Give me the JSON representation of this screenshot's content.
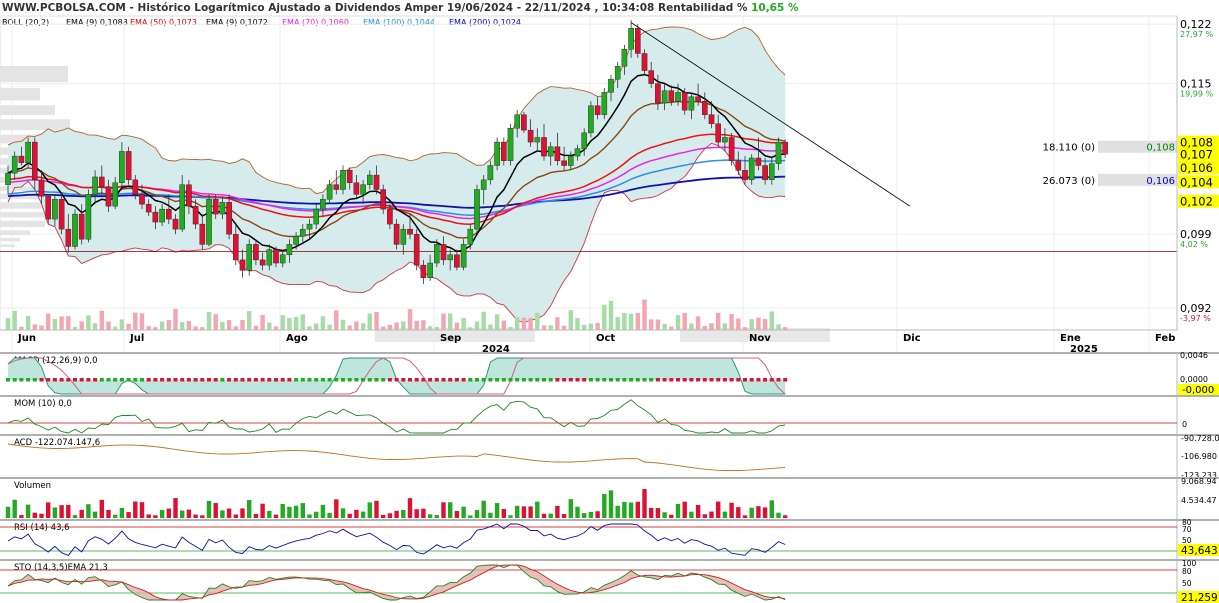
{
  "header": {
    "site": "WWW.PCBOLSA.COM",
    "title_rest": " - Histórico Logarítmico  Ajustado a Dividendos Amper 19/06/2024 - 22/11/2024 , 10:34:08 Rentabilidad %",
    "rentabilidad": "10,65 %"
  },
  "legend": [
    {
      "label": "BOLL (20,2)",
      "color": "#000000"
    },
    {
      "label": "EMA (9) 0,1088",
      "color": "#000000"
    },
    {
      "label": "EMA (50) 0,1073",
      "color": "#e00000"
    },
    {
      "label": "EMA (9) 0,1072",
      "color": "#000000"
    },
    {
      "label": "EMA (70) 0,1060",
      "color": "#e020e0"
    },
    {
      "label": "EMA (100) 0,1044",
      "color": "#2090e0"
    },
    {
      "label": "EMA (200) 0,1024",
      "color": "#0000c0"
    }
  ],
  "colors": {
    "up": "#22aa22",
    "down": "#dd1133",
    "boll_fill": "#d6ecec",
    "boll_line": "#b8602a",
    "ema9": "#000000",
    "ema_brown": "#8b4513",
    "ema50": "#ee1111",
    "ema70": "#ee22ee",
    "ema100": "#2b90e0",
    "ema200": "#1010b0",
    "highlight": "#ffff00",
    "pane_sep": "#b0b0b0"
  },
  "price_axis": {
    "labels": [
      {
        "text": "0,122",
        "pct": "27,97 %",
        "val": 0.122
      },
      {
        "text": "0,115",
        "pct": "19,99 %",
        "val": 0.115
      },
      {
        "text": "0,099",
        "pct": "4,02 %",
        "val": 0.099
      },
      {
        "text": "0,092",
        "pct": "-3,97 %",
        "val": 0.092
      }
    ],
    "boxes": [
      {
        "text": "0,108",
        "val": 0.1085
      },
      {
        "text": "0,107",
        "val": 0.1072
      },
      {
        "text": "0,106",
        "val": 0.1058
      },
      {
        "text": "0,104",
        "val": 0.1043
      },
      {
        "text": "0,102",
        "val": 0.1023
      }
    ],
    "orders": [
      {
        "qty": "18.110 (0)",
        "price": "0,108",
        "val": 0.108,
        "color": "#008800"
      },
      {
        "qty": "26.073 (0)",
        "price": "0,106",
        "val": 0.1045,
        "color": "#0000cc"
      }
    ],
    "hline": 0.0973
  },
  "time_axis": {
    "months": [
      "Jun",
      "Jul",
      "Ago",
      "Sep",
      "Oct",
      "Nov",
      "Dic",
      "Ene",
      "Feb"
    ],
    "years": [
      "2024",
      "2025"
    ]
  },
  "panes": {
    "macd": {
      "label": "MACD (12,26,9) 0,0",
      "ticks": [
        "0,0046",
        "0,0000"
      ],
      "box": "-0,000"
    },
    "mom": {
      "label": "MOM (10) 0,0",
      "ticks": [
        "0"
      ]
    },
    "acd": {
      "label": "ACD -122.074.147,6",
      "ticks": [
        "-90.728.0",
        "-106.980",
        "-123.233"
      ]
    },
    "volumen": {
      "label": "Volumen",
      "ticks": [
        "9.068.94",
        "4.534.47"
      ]
    },
    "rsi": {
      "label": "RSI (14) 43,6",
      "ticks": [
        "80",
        "70",
        "50",
        "30"
      ],
      "box": "43,643"
    },
    "sto": {
      "label": "STO (14,3,5)EMA 21,3",
      "ticks": [
        "100",
        "80",
        "50",
        "20"
      ],
      "box": "21,259"
    }
  },
  "chart_data": {
    "type": "candlestick",
    "title": "Amper 19/06/2024 - 22/11/2024",
    "scale": "log",
    "ylim": [
      0.09,
      0.123
    ],
    "candles": [
      [
        0.104,
        0.106,
        0.103,
        0.1052
      ],
      [
        0.1052,
        0.1075,
        0.1045,
        0.107
      ],
      [
        0.107,
        0.108,
        0.106,
        0.1063
      ],
      [
        0.1063,
        0.109,
        0.1058,
        0.1085
      ],
      [
        0.1085,
        0.109,
        0.1035,
        0.1045
      ],
      [
        0.1045,
        0.1055,
        0.102,
        0.1028
      ],
      [
        0.1028,
        0.103,
        0.1,
        0.1005
      ],
      [
        0.1005,
        0.103,
        0.0998,
        0.1025
      ],
      [
        0.1025,
        0.1032,
        0.099,
        0.0995
      ],
      [
        0.0995,
        0.101,
        0.0972,
        0.0978
      ],
      [
        0.0978,
        0.1015,
        0.0975,
        0.101
      ],
      [
        0.101,
        0.102,
        0.098,
        0.0985
      ],
      [
        0.0985,
        0.1035,
        0.0982,
        0.103
      ],
      [
        0.103,
        0.1055,
        0.102,
        0.1048
      ],
      [
        0.1048,
        0.106,
        0.103,
        0.1038
      ],
      [
        0.1038,
        0.1045,
        0.1012,
        0.1018
      ],
      [
        0.1018,
        0.1048,
        0.1015,
        0.1042
      ],
      [
        0.1042,
        0.1085,
        0.1038,
        0.1075
      ],
      [
        0.1075,
        0.108,
        0.104,
        0.1045
      ],
      [
        0.1045,
        0.105,
        0.1025,
        0.103
      ],
      [
        0.103,
        0.104,
        0.1015,
        0.102
      ],
      [
        0.102,
        0.1025,
        0.1008,
        0.1012
      ],
      [
        0.1012,
        0.1018,
        0.0995,
        0.1002
      ],
      [
        0.1002,
        0.102,
        0.0998,
        0.1015
      ],
      [
        0.1015,
        0.103,
        0.1,
        0.1005
      ],
      [
        0.1005,
        0.101,
        0.099,
        0.0995
      ],
      [
        0.0995,
        0.105,
        0.0992,
        0.104
      ],
      [
        0.104,
        0.1045,
        0.101,
        0.1018
      ],
      [
        0.1018,
        0.1025,
        0.0995,
        0.1
      ],
      [
        0.1,
        0.101,
        0.0975,
        0.098
      ],
      [
        0.098,
        0.103,
        0.0978,
        0.1025
      ],
      [
        0.1025,
        0.103,
        0.1005,
        0.101
      ],
      [
        0.101,
        0.1028,
        0.1005,
        0.1022
      ],
      [
        0.1022,
        0.103,
        0.0985,
        0.099
      ],
      [
        0.099,
        0.1,
        0.096,
        0.0965
      ],
      [
        0.0965,
        0.0975,
        0.0948,
        0.0955
      ],
      [
        0.0955,
        0.0985,
        0.095,
        0.098
      ],
      [
        0.098,
        0.0985,
        0.096,
        0.0965
      ],
      [
        0.0965,
        0.0972,
        0.0955,
        0.096
      ],
      [
        0.096,
        0.098,
        0.0955,
        0.0975
      ],
      [
        0.0975,
        0.0978,
        0.0958,
        0.0962
      ],
      [
        0.0962,
        0.0975,
        0.0958,
        0.097
      ],
      [
        0.097,
        0.0985,
        0.0962,
        0.098
      ],
      [
        0.098,
        0.0992,
        0.0975,
        0.0988
      ],
      [
        0.0988,
        0.1,
        0.098,
        0.0995
      ],
      [
        0.0995,
        0.1005,
        0.0985,
        0.1
      ],
      [
        0.1,
        0.102,
        0.0995,
        0.1015
      ],
      [
        0.1015,
        0.103,
        0.1008,
        0.1025
      ],
      [
        0.1025,
        0.1045,
        0.102,
        0.104
      ],
      [
        0.104,
        0.1055,
        0.103,
        0.1035
      ],
      [
        0.1035,
        0.106,
        0.103,
        0.1055
      ],
      [
        0.1055,
        0.1058,
        0.1035,
        0.1042
      ],
      [
        0.1042,
        0.105,
        0.1025,
        0.103
      ],
      [
        0.103,
        0.1045,
        0.102,
        0.104
      ],
      [
        0.104,
        0.1055,
        0.1035,
        0.105
      ],
      [
        0.105,
        0.106,
        0.103,
        0.1035
      ],
      [
        0.1035,
        0.104,
        0.101,
        0.1015
      ],
      [
        0.1015,
        0.102,
        0.0995,
        0.1
      ],
      [
        0.1,
        0.1005,
        0.0975,
        0.098
      ],
      [
        0.098,
        0.1,
        0.097,
        0.0995
      ],
      [
        0.0995,
        0.101,
        0.0985,
        0.099
      ],
      [
        0.099,
        0.0995,
        0.0955,
        0.096
      ],
      [
        0.096,
        0.0965,
        0.0942,
        0.0948
      ],
      [
        0.0948,
        0.097,
        0.0945,
        0.0962
      ],
      [
        0.0962,
        0.0985,
        0.0958,
        0.098
      ],
      [
        0.098,
        0.0988,
        0.096,
        0.0965
      ],
      [
        0.0965,
        0.0975,
        0.0955,
        0.097
      ],
      [
        0.097,
        0.0975,
        0.0955,
        0.0958
      ],
      [
        0.0958,
        0.0985,
        0.0955,
        0.098
      ],
      [
        0.098,
        0.1,
        0.0975,
        0.0995
      ],
      [
        0.0995,
        0.104,
        0.099,
        0.1035
      ],
      [
        0.1035,
        0.105,
        0.102,
        0.1045
      ],
      [
        0.1045,
        0.1065,
        0.104,
        0.106
      ],
      [
        0.106,
        0.109,
        0.1055,
        0.1085
      ],
      [
        0.1085,
        0.109,
        0.106,
        0.1065
      ],
      [
        0.1065,
        0.1105,
        0.106,
        0.11
      ],
      [
        0.11,
        0.112,
        0.109,
        0.1115
      ],
      [
        0.1115,
        0.1118,
        0.1095,
        0.1098
      ],
      [
        0.1098,
        0.111,
        0.108,
        0.1085
      ],
      [
        0.1085,
        0.11,
        0.1075,
        0.109
      ],
      [
        0.109,
        0.1105,
        0.1065,
        0.107
      ],
      [
        0.107,
        0.1085,
        0.106,
        0.108
      ],
      [
        0.108,
        0.1095,
        0.106,
        0.1065
      ],
      [
        0.1065,
        0.108,
        0.1055,
        0.106
      ],
      [
        0.106,
        0.1075,
        0.1055,
        0.107
      ],
      [
        0.107,
        0.1082,
        0.1065,
        0.1078
      ],
      [
        0.1078,
        0.11,
        0.107,
        0.1095
      ],
      [
        0.1095,
        0.113,
        0.109,
        0.1125
      ],
      [
        0.1125,
        0.1135,
        0.111,
        0.1115
      ],
      [
        0.1115,
        0.1145,
        0.111,
        0.114
      ],
      [
        0.114,
        0.116,
        0.113,
        0.1155
      ],
      [
        0.1155,
        0.1175,
        0.1145,
        0.117
      ],
      [
        0.117,
        0.1195,
        0.116,
        0.119
      ],
      [
        0.119,
        0.1225,
        0.118,
        0.1215
      ],
      [
        0.1215,
        0.122,
        0.118,
        0.1185
      ],
      [
        0.1185,
        0.119,
        0.116,
        0.1165
      ],
      [
        0.1165,
        0.1175,
        0.1145,
        0.115
      ],
      [
        0.115,
        0.116,
        0.112,
        0.1128
      ],
      [
        0.1128,
        0.115,
        0.112,
        0.1142
      ],
      [
        0.1142,
        0.1148,
        0.1125,
        0.113
      ],
      [
        0.113,
        0.115,
        0.1125,
        0.114
      ],
      [
        0.114,
        0.1145,
        0.1115,
        0.112
      ],
      [
        0.112,
        0.114,
        0.111,
        0.1135
      ],
      [
        0.1135,
        0.115,
        0.1125,
        0.113
      ],
      [
        0.113,
        0.114,
        0.111,
        0.1115
      ],
      [
        0.1115,
        0.113,
        0.11,
        0.1105
      ],
      [
        0.1105,
        0.1115,
        0.108,
        0.1085
      ],
      [
        0.1085,
        0.11,
        0.1075,
        0.109
      ],
      [
        0.109,
        0.1095,
        0.106,
        0.1065
      ],
      [
        0.1065,
        0.1075,
        0.105,
        0.1055
      ],
      [
        0.1055,
        0.107,
        0.104,
        0.1045
      ],
      [
        0.1045,
        0.1072,
        0.104,
        0.1068
      ],
      [
        0.1068,
        0.109,
        0.1055,
        0.106
      ],
      [
        0.106,
        0.1068,
        0.104,
        0.1045
      ],
      [
        0.1045,
        0.107,
        0.104,
        0.1062
      ],
      [
        0.1062,
        0.109,
        0.1055,
        0.1085
      ],
      [
        0.1085,
        0.1088,
        0.1068,
        0.1072
      ]
    ],
    "volume_scale": [
      0,
      12000000
    ]
  }
}
